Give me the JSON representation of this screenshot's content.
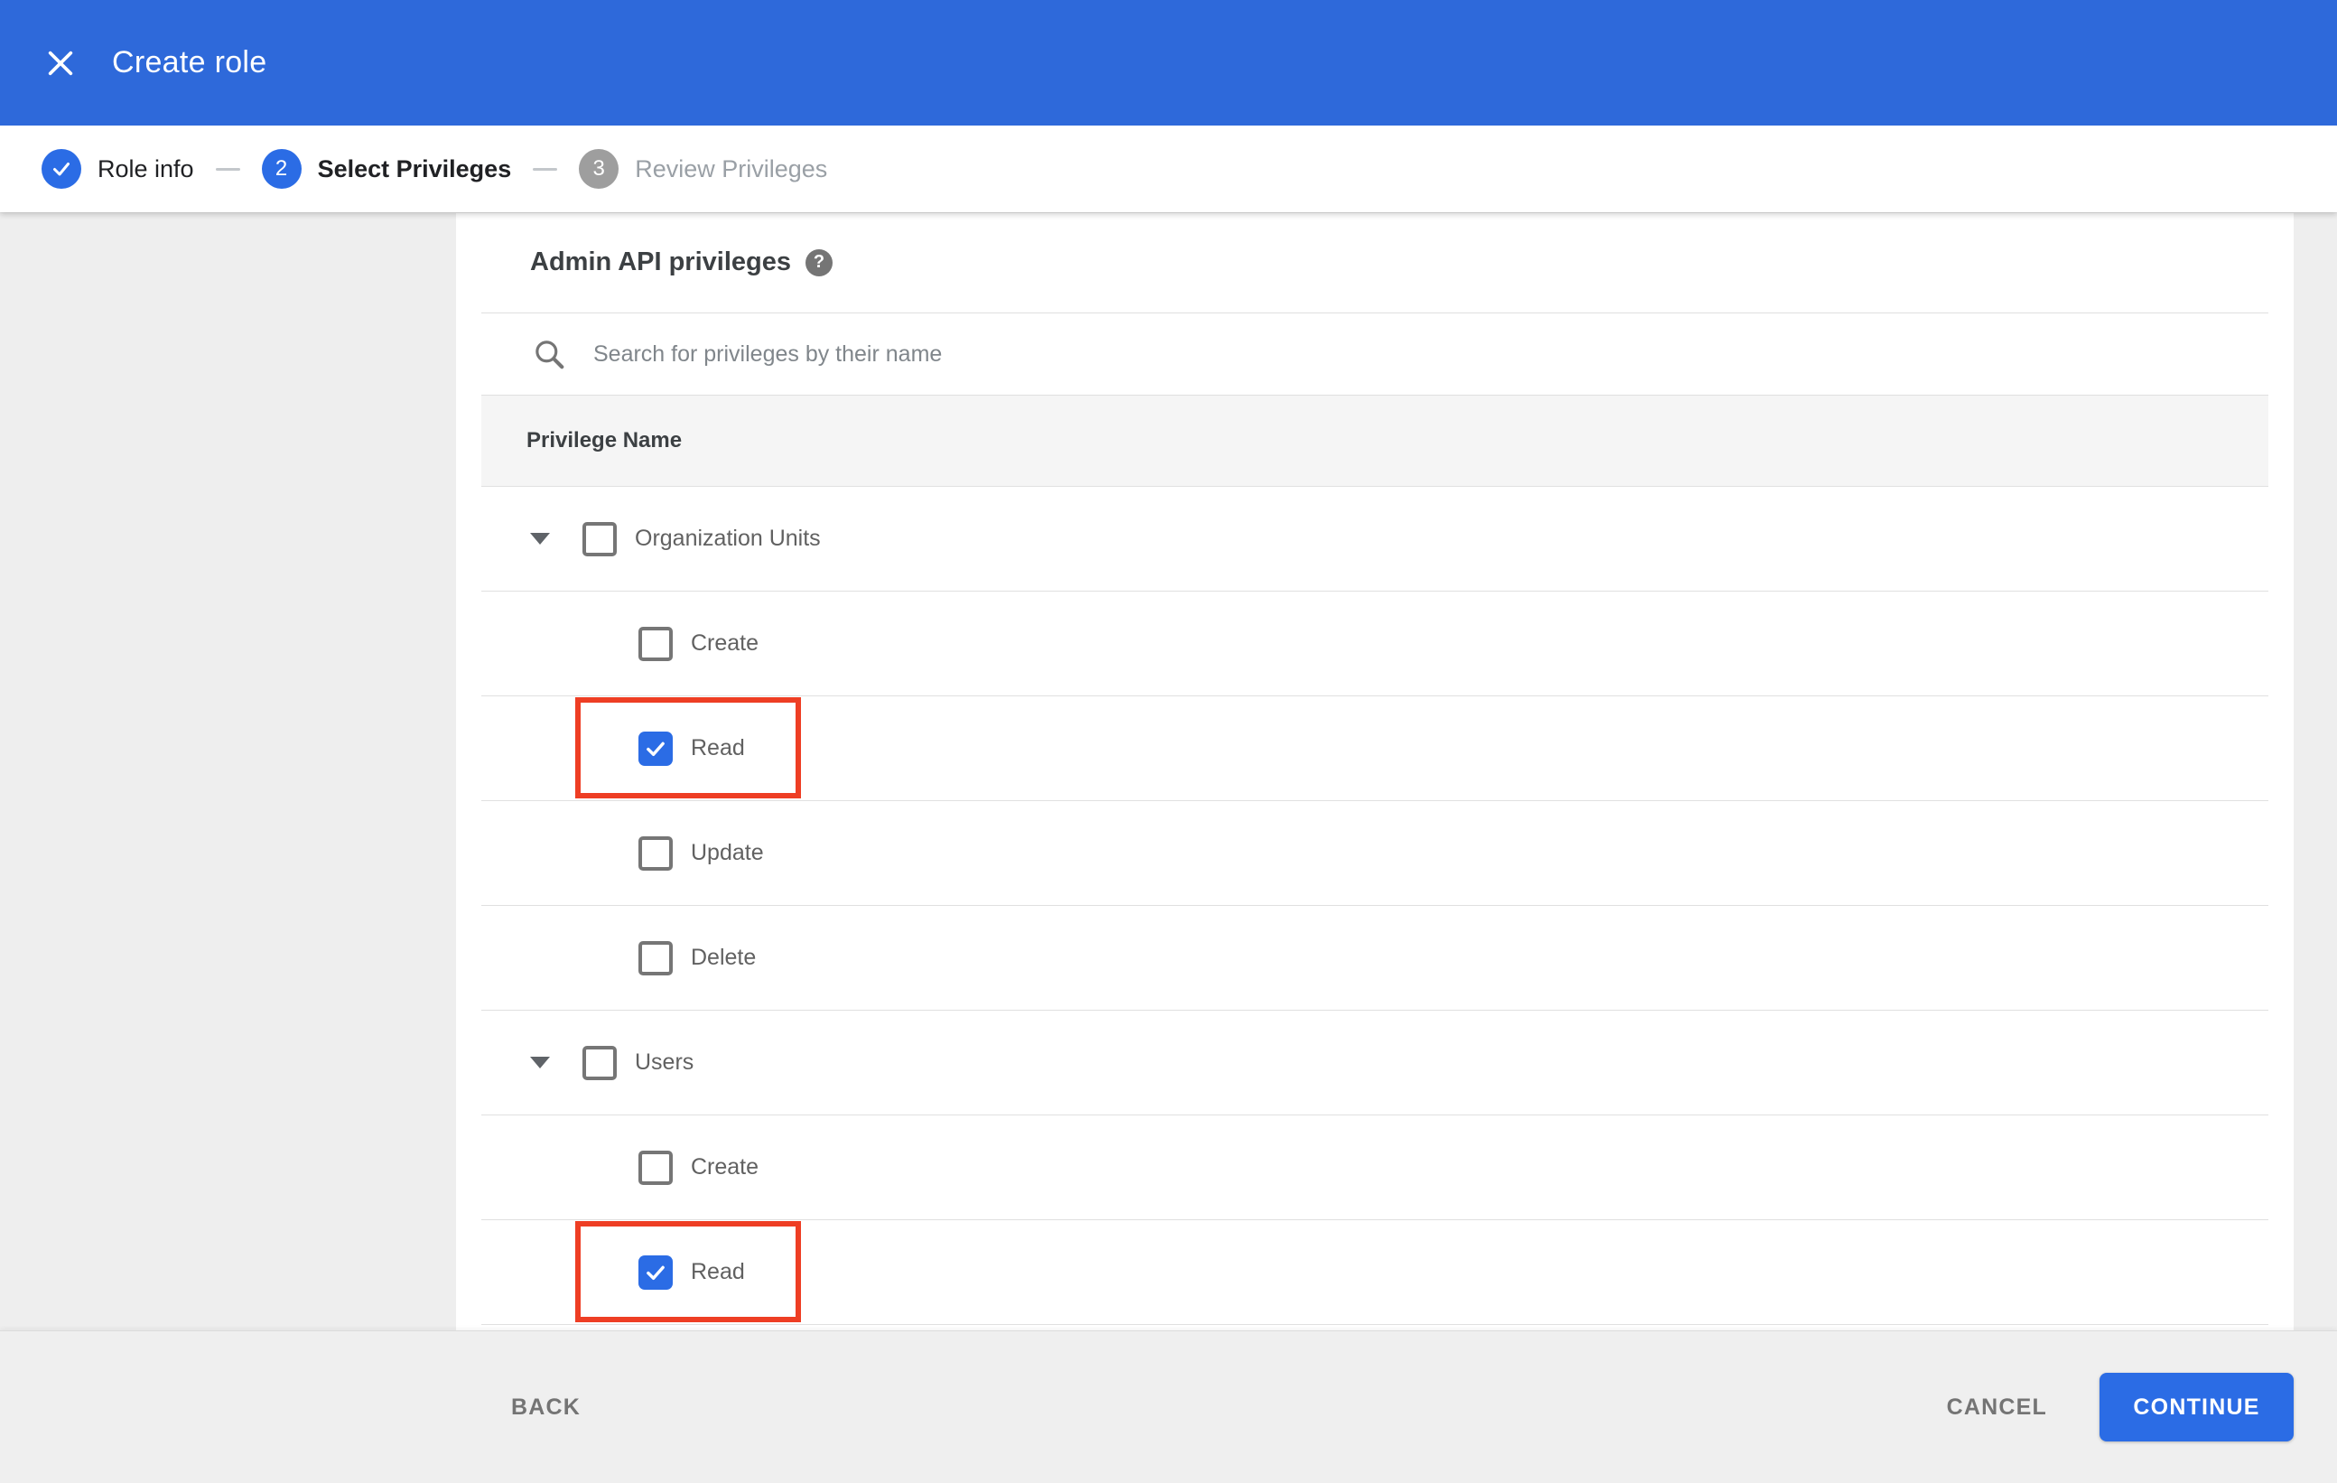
{
  "app": {
    "title": "Create role"
  },
  "colors": {
    "appbar_blue": "#2e69da",
    "accent_blue": "#2b6ce5",
    "annotation_red": "#ee3e24",
    "page_background": "#eeeeee",
    "table_header_background": "#f5f5f5",
    "row_border": "#e0e0e0"
  },
  "stepper": {
    "steps": [
      {
        "number": "1",
        "label": "Role info",
        "state": "completed"
      },
      {
        "number": "2",
        "label": "Select Privileges",
        "state": "active"
      },
      {
        "number": "3",
        "label": "Review Privileges",
        "state": "upcoming"
      }
    ]
  },
  "content": {
    "heading": "Admin API privileges",
    "help_icon": "question-mark",
    "search": {
      "placeholder": "Search for privileges by their name",
      "value": ""
    },
    "table": {
      "header": "Privilege Name",
      "rows": [
        {
          "label": "Organization Units",
          "type": "parent",
          "checked": false,
          "highlighted": false
        },
        {
          "label": "Create",
          "type": "child",
          "checked": false,
          "highlighted": false
        },
        {
          "label": "Read",
          "type": "child",
          "checked": true,
          "highlighted": true
        },
        {
          "label": "Update",
          "type": "child",
          "checked": false,
          "highlighted": false
        },
        {
          "label": "Delete",
          "type": "child",
          "checked": false,
          "highlighted": false
        },
        {
          "label": "Users",
          "type": "parent",
          "checked": false,
          "highlighted": false
        },
        {
          "label": "Create",
          "type": "child",
          "checked": false,
          "highlighted": false
        },
        {
          "label": "Read",
          "type": "child",
          "checked": true,
          "highlighted": true
        }
      ]
    }
  },
  "footer": {
    "back": "BACK",
    "cancel": "CANCEL",
    "continue": "CONTINUE"
  }
}
